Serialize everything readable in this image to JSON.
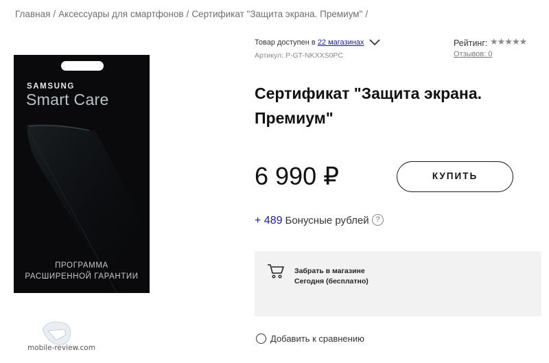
{
  "breadcrumb": {
    "items": [
      "Главная",
      "Аксессуары для смартфонов",
      "Сертификат \"Защита экрана. Премиум\""
    ],
    "separator": "/"
  },
  "product_image": {
    "brand": "SAMSUNG",
    "brand_sub": "Smart Care",
    "line1": "ПРОГРАММА",
    "line2": "РАСШИРЕННОЙ ГАРАНТИИ"
  },
  "watermark": "mobile-review.com",
  "availability": {
    "prefix": "Товар доступен в",
    "link": "22 магазинах",
    "sku": "Артикул: P-GT-NKXXS0PC"
  },
  "rating": {
    "label": "Рейтинг:",
    "stars": "★★★★★",
    "reviews": "Отзывов: 0"
  },
  "product": {
    "title": "Сертификат \"Защита экрана. Премиум\"",
    "price": "6 990 ₽",
    "buy_label": "КУПИТЬ"
  },
  "bonus": {
    "amount": "+ 489",
    "label": "Бонусные рублей",
    "help": "?"
  },
  "pickup": {
    "title": "Забрать в магазине",
    "subtitle": "Сегодня (бесплатно)"
  },
  "compare": {
    "label": "Добавить к сравнению"
  },
  "colors": {
    "link": "#1a1ab0",
    "card_bg": "#0a0a0c",
    "pickup_bg": "#f2f2f2"
  }
}
